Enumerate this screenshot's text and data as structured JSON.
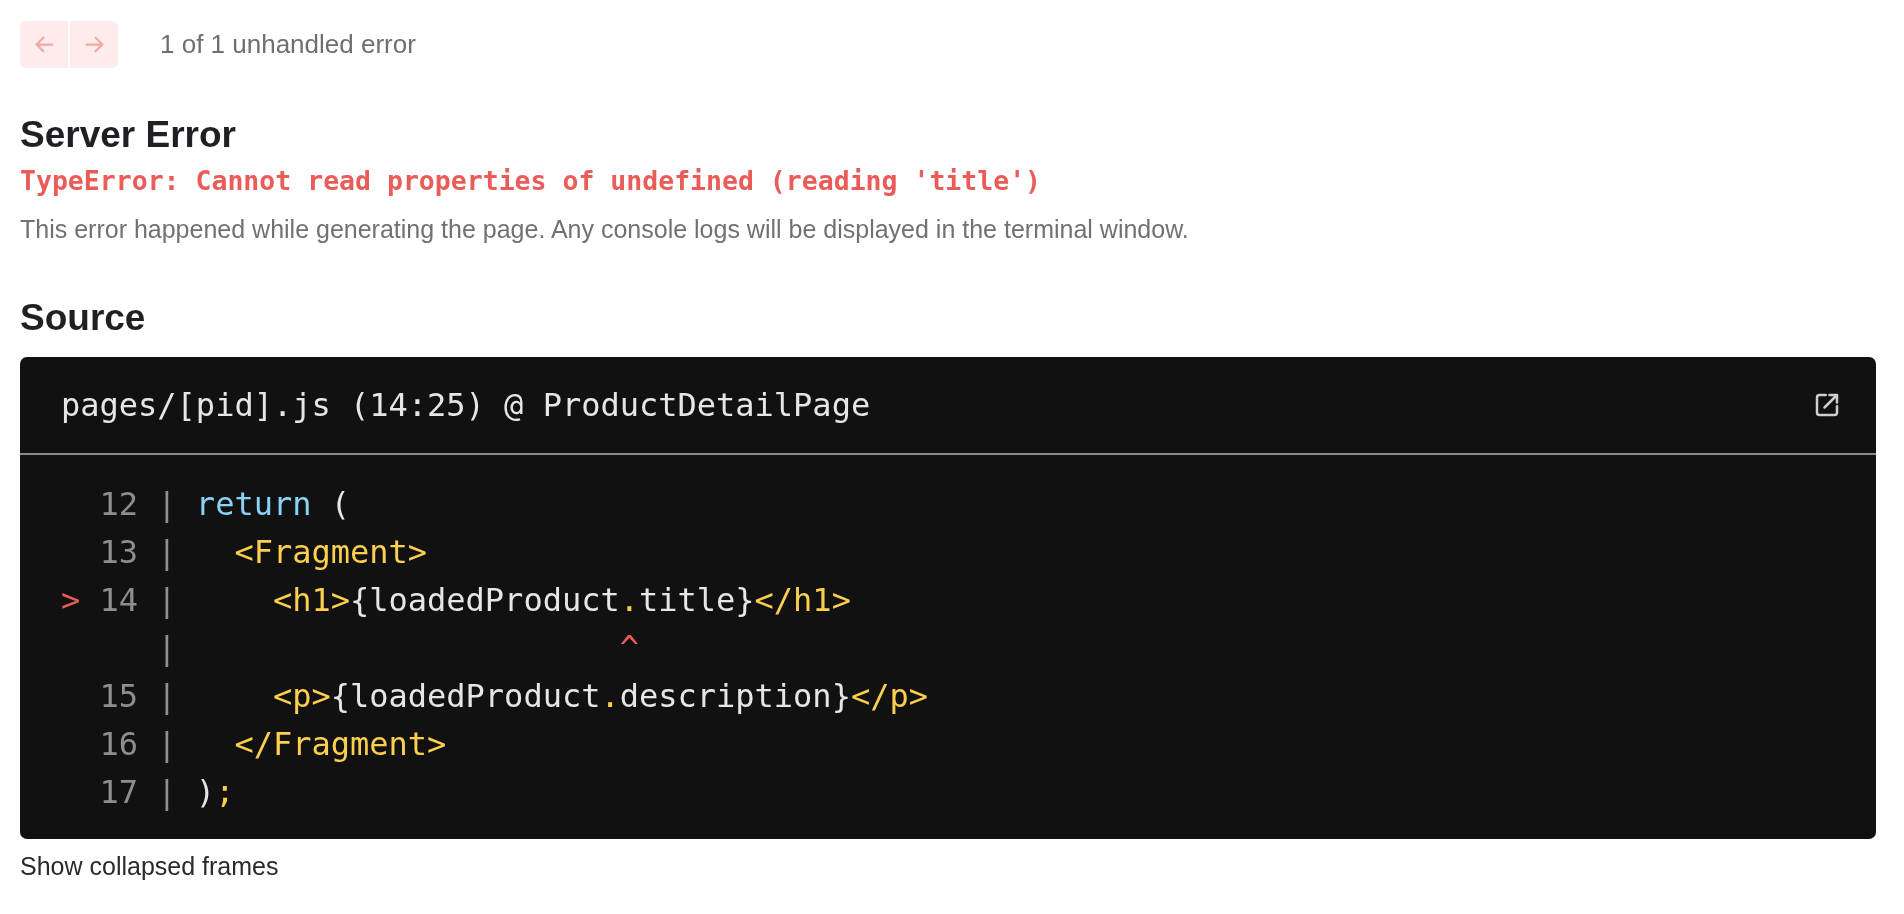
{
  "nav": {
    "buttons": [
      {
        "kind": "previous",
        "disabled": true
      },
      {
        "kind": "next",
        "disabled": true
      }
    ],
    "counter": "1 of 1 unhandled error"
  },
  "title": "Server Error",
  "error_message": "TypeError: Cannot read properties of undefined (reading 'title')",
  "description": "This error happened while generating the page. Any console logs will be displayed in the terminal window.",
  "source": {
    "heading": "Source",
    "file": "pages/[pid].js (14:25) @ ProductDetailPage",
    "lines": [
      {
        "kind": "code",
        "number": "12",
        "gutter": "|",
        "tokens": [
          {
            "kind": "keyword",
            "text": "return"
          },
          {
            "kind": "text",
            "text": " ("
          }
        ]
      },
      {
        "kind": "code",
        "number": "13",
        "gutter": "|",
        "tokens": [
          {
            "kind": "tag",
            "text": "  <Fragment>"
          }
        ]
      },
      {
        "kind": "code",
        "marker": ">",
        "number": "14",
        "gutter": "|",
        "tokens": [
          {
            "kind": "tag",
            "text": "    <h1>"
          },
          {
            "kind": "text",
            "text": "{loadedProduct"
          },
          {
            "kind": "tag",
            "text": "."
          },
          {
            "kind": "text",
            "text": "title}"
          },
          {
            "kind": "tag",
            "text": "</h1>"
          }
        ]
      },
      {
        "kind": "caret",
        "gutter": "|",
        "text": "                      ^"
      },
      {
        "kind": "code",
        "number": "15",
        "gutter": "|",
        "tokens": [
          {
            "kind": "tag",
            "text": "    <p>"
          },
          {
            "kind": "text",
            "text": "{loadedProduct"
          },
          {
            "kind": "tag",
            "text": "."
          },
          {
            "kind": "text",
            "text": "description}"
          },
          {
            "kind": "tag",
            "text": "</p>"
          }
        ]
      },
      {
        "kind": "code",
        "number": "16",
        "gutter": "|",
        "tokens": [
          {
            "kind": "tag",
            "text": "  </Fragment>"
          }
        ]
      },
      {
        "kind": "code",
        "number": "17",
        "gutter": "|",
        "tokens": [
          {
            "kind": "text",
            "text": ")"
          },
          {
            "kind": "tag",
            "text": ";"
          }
        ]
      }
    ]
  },
  "show_collapsed_frames": "Show collapsed frames"
}
